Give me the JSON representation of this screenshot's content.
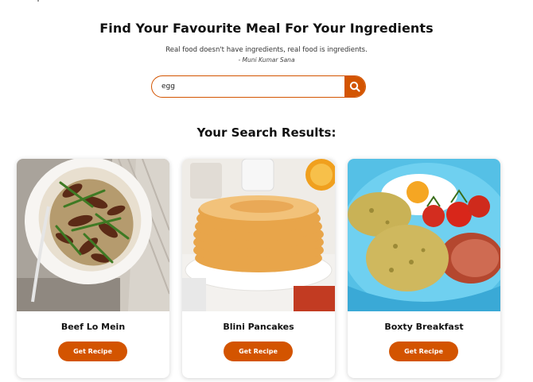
{
  "header": {
    "title": "Find Your Favourite Meal For Your Ingredients",
    "quote": "Real food doesn't have ingredients, real food is ingredients.",
    "author": "- Muni Kumar Sana"
  },
  "search": {
    "value": "egg",
    "icon": "search-icon"
  },
  "results": {
    "title": "Your Search Results:",
    "items": [
      {
        "name": "Beef Lo Mein",
        "button": "Get Recipe"
      },
      {
        "name": "Blini Pancakes",
        "button": "Get Recipe"
      },
      {
        "name": "Boxty Breakfast",
        "button": "Get Recipe"
      }
    ]
  },
  "colors": {
    "accent": "#d35400"
  }
}
